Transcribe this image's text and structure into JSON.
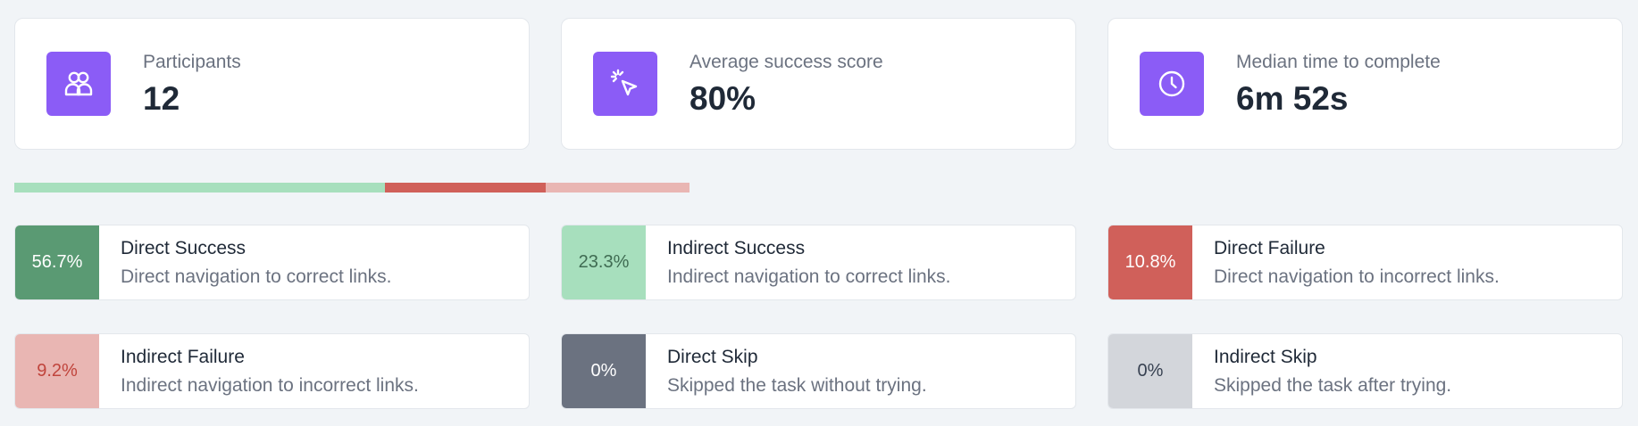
{
  "stats": [
    {
      "label": "Participants",
      "value": "12",
      "icon": "participants-icon"
    },
    {
      "label": "Average success score",
      "value": "80%",
      "icon": "cursor-click-icon"
    },
    {
      "label": "Median time to complete",
      "value": "6m 52s",
      "icon": "clock-icon"
    }
  ],
  "colors": {
    "accent": "#8b5cf6",
    "direct_success": "#5a9a73",
    "indirect_success": "#a7dfbd",
    "direct_failure": "#d0605a",
    "indirect_failure": "#e9b6b3",
    "direct_skip": "#6b7280",
    "indirect_skip": "#d3d6db"
  },
  "progress": {
    "segments": [
      {
        "name": "Direct Success",
        "percent": 56.7,
        "color": "#a7dfbd"
      },
      {
        "name": "Direct Failure",
        "percent": 24.7,
        "color": "#d0605a"
      },
      {
        "name": "Indirect Failure",
        "percent": 22.0,
        "color": "#e9b6b3"
      }
    ]
  },
  "outcomes": [
    {
      "percent": "56.7%",
      "title": "Direct Success",
      "desc": "Direct navigation to correct links.",
      "bg": "#5a9a73",
      "fg": "#ffffff"
    },
    {
      "percent": "23.3%",
      "title": "Indirect Success",
      "desc": "Indirect navigation to correct links.",
      "bg": "#a7dfbd",
      "fg": "#3f6b52"
    },
    {
      "percent": "10.8%",
      "title": "Direct Failure",
      "desc": "Direct navigation to incorrect links.",
      "bg": "#d0605a",
      "fg": "#ffffff"
    },
    {
      "percent": "9.2%",
      "title": "Indirect Failure",
      "desc": "Indirect navigation to incorrect links.",
      "bg": "#e9b6b3",
      "fg": "#c0443c"
    },
    {
      "percent": "0%",
      "title": "Direct Skip",
      "desc": "Skipped the task without trying.",
      "bg": "#6b7280",
      "fg": "#ffffff"
    },
    {
      "percent": "0%",
      "title": "Indirect Skip",
      "desc": "Skipped the task after trying.",
      "bg": "#d3d6db",
      "fg": "#374151"
    }
  ]
}
